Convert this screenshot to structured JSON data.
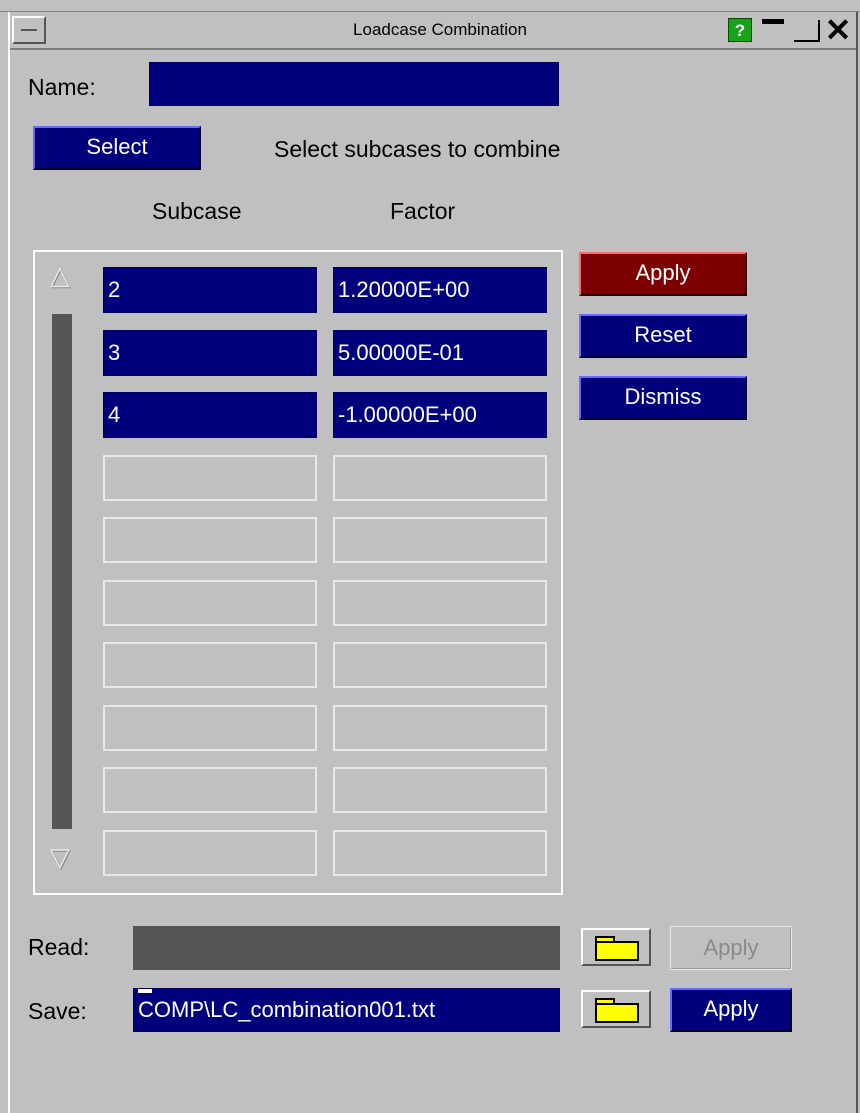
{
  "window": {
    "title": "Loadcase Combination",
    "help_label": "?"
  },
  "name": {
    "label": "Name:",
    "value": ""
  },
  "select": {
    "button_label": "Select",
    "hint": "Select subcases to combine"
  },
  "columns": {
    "subcase": "Subcase",
    "factor": "Factor"
  },
  "rows": [
    {
      "subcase": "2",
      "factor": "1.20000E+00"
    },
    {
      "subcase": "3",
      "factor": "5.00000E-01"
    },
    {
      "subcase": "4",
      "factor": "-1.00000E+00"
    },
    {
      "subcase": "",
      "factor": ""
    },
    {
      "subcase": "",
      "factor": ""
    },
    {
      "subcase": "",
      "factor": ""
    },
    {
      "subcase": "",
      "factor": ""
    },
    {
      "subcase": "",
      "factor": ""
    },
    {
      "subcase": "",
      "factor": ""
    },
    {
      "subcase": "",
      "factor": ""
    }
  ],
  "actions": {
    "apply": "Apply",
    "reset": "Reset",
    "dismiss": "Dismiss"
  },
  "read": {
    "label": "Read:",
    "value": "",
    "apply_label": "Apply"
  },
  "save": {
    "label": "Save:",
    "value": "COMP\\LC_combination001.txt",
    "apply_label": "Apply"
  },
  "icons": {
    "folder": "folder-icon",
    "scroll_up": "scroll-up-arrow-icon",
    "scroll_down": "scroll-down-arrow-icon"
  },
  "colors": {
    "field": "#00007d",
    "apply_red": "#7d0000",
    "background": "#c0c0c0"
  }
}
